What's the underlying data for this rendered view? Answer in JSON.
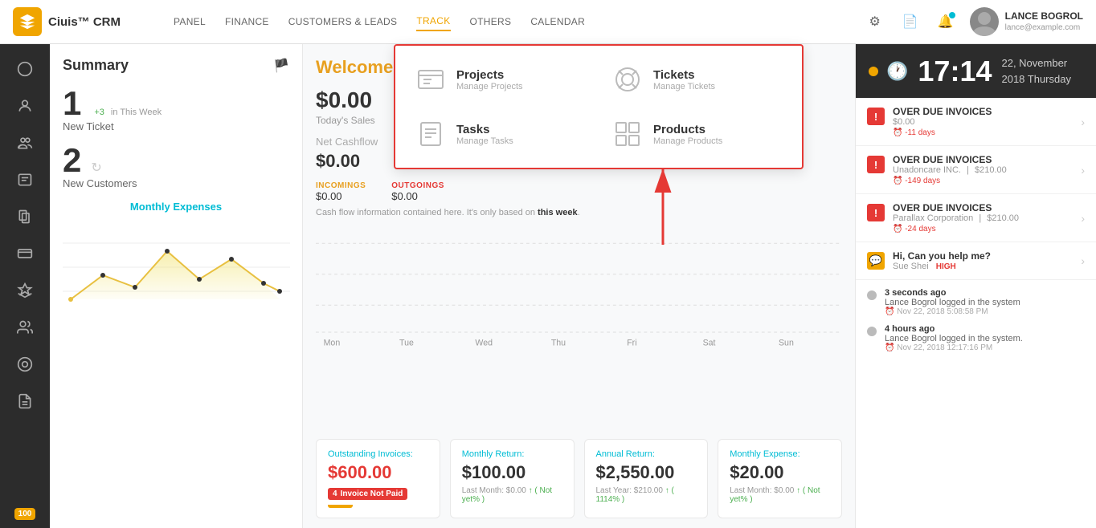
{
  "app": {
    "logo_text": "Ciuis™ CRM"
  },
  "nav": {
    "items": [
      {
        "label": "PANEL",
        "active": false
      },
      {
        "label": "FINANCE",
        "active": false
      },
      {
        "label": "CUSTOMERS & LEADS",
        "active": false
      },
      {
        "label": "TRACK",
        "active": true
      },
      {
        "label": "OTHERS",
        "active": false
      },
      {
        "label": "CALENDAR",
        "active": false
      }
    ]
  },
  "user": {
    "name": "LANCE BOGROL",
    "email": "lance@example.com"
  },
  "sidebar": {
    "items": [
      {
        "icon": "○",
        "active": false,
        "name": "dashboard"
      },
      {
        "icon": "👤",
        "active": false,
        "name": "profile"
      },
      {
        "icon": "👥",
        "active": false,
        "name": "users"
      },
      {
        "icon": "📋",
        "active": false,
        "name": "tasks"
      },
      {
        "icon": "📄",
        "active": false,
        "name": "documents"
      },
      {
        "icon": "💰",
        "active": false,
        "name": "finance"
      },
      {
        "icon": "✈",
        "active": false,
        "name": "travel"
      },
      {
        "icon": "👨‍👩‍👧",
        "active": false,
        "name": "team"
      },
      {
        "icon": "⊙",
        "active": false,
        "name": "support"
      },
      {
        "icon": "📝",
        "active": false,
        "name": "notes"
      }
    ],
    "badge": "100"
  },
  "summary": {
    "title": "Summary",
    "new_ticket_count": "1",
    "new_ticket_label": "New Ticket",
    "new_ticket_delta": "+3",
    "new_ticket_sub": "in This Week",
    "new_customer_count": "2",
    "new_customer_label": "New Customers",
    "monthly_expenses_title": "Monthly Expenses"
  },
  "welcome": {
    "title": "Welcome",
    "todays_sales_label": "Today's Sales",
    "todays_sales_value": "$0.00",
    "net_cashflow_title": "Net Cashflow",
    "net_cashflow_value": "$0.00",
    "incomings_label": "INCOMINGS",
    "incomings_value": "$0.00",
    "outgoings_label": "OUTGOINGS",
    "outgoings_value": "$0.00",
    "cashflow_note": "Cash flow information contained here. It's only based on ",
    "cashflow_note_bold": "this week",
    "chart_days": [
      "Mon",
      "Tue",
      "Wed",
      "Thu",
      "Fri",
      "Sat",
      "Sun"
    ]
  },
  "bottom_cards": [
    {
      "title": "Outstanding Invoices:",
      "amount": "$600.00",
      "amount_color": "red",
      "badge": "4",
      "badge_label": "Invoice Not Paid",
      "bar_width": "25%"
    },
    {
      "title": "Monthly Return:",
      "amount": "$100.00",
      "amount_color": "normal",
      "sub_label": "Last Month:",
      "sub_value": "$0.00",
      "sub_extra": "↑ ( Not yet% )"
    },
    {
      "title": "Annual Return:",
      "amount": "$2,550.00",
      "amount_color": "normal",
      "sub_label": "Last Year:",
      "sub_value": "$210.00",
      "sub_extra": "↑ ( 1114% )"
    },
    {
      "title": "Monthly Expense:",
      "amount": "$20.00",
      "amount_color": "normal",
      "sub_label": "Last Month:",
      "sub_value": "$0.00",
      "sub_extra": "↑ ( Not yet% )"
    }
  ],
  "right_panel": {
    "clock": {
      "time": "17:14",
      "date_line1": "22, November",
      "date_line2": "2018 Thursday"
    },
    "invoices": [
      {
        "type": "overdue",
        "title": "OVER DUE INVOICES",
        "amount": "$0.00",
        "days": "⏰ -11 days"
      },
      {
        "type": "overdue",
        "title": "OVER DUE INVOICES",
        "company": "Unadoncare INC.",
        "amount": "$210.00",
        "days": "⏰ -149 days"
      },
      {
        "type": "overdue",
        "title": "OVER DUE INVOICES",
        "company": "Parallax Corporation",
        "amount": "$210.00",
        "days": "⏰ -24 days"
      },
      {
        "type": "chat",
        "title": "Hi, Can you help me?",
        "from": "Sue Shei",
        "priority": "HIGH"
      }
    ],
    "activity": [
      {
        "time": "3 seconds ago",
        "text": "Lance Bogrol logged in the system",
        "timestamp": "⏰ Nov 22, 2018 5:08:58 PM"
      },
      {
        "time": "4 hours ago",
        "text": "Lance Bogrol logged in the system.",
        "timestamp": "⏰ Nov 22, 2018 12:17:16 PM"
      }
    ]
  },
  "track_dropdown": {
    "items": [
      {
        "title": "Projects",
        "subtitle": "Manage Projects",
        "icon": "projects"
      },
      {
        "title": "Tickets",
        "subtitle": "Manage Tickets",
        "icon": "tickets"
      },
      {
        "title": "Tasks",
        "subtitle": "Manage Tasks",
        "icon": "tasks"
      },
      {
        "title": "Products",
        "subtitle": "Manage Products",
        "icon": "products"
      }
    ]
  }
}
